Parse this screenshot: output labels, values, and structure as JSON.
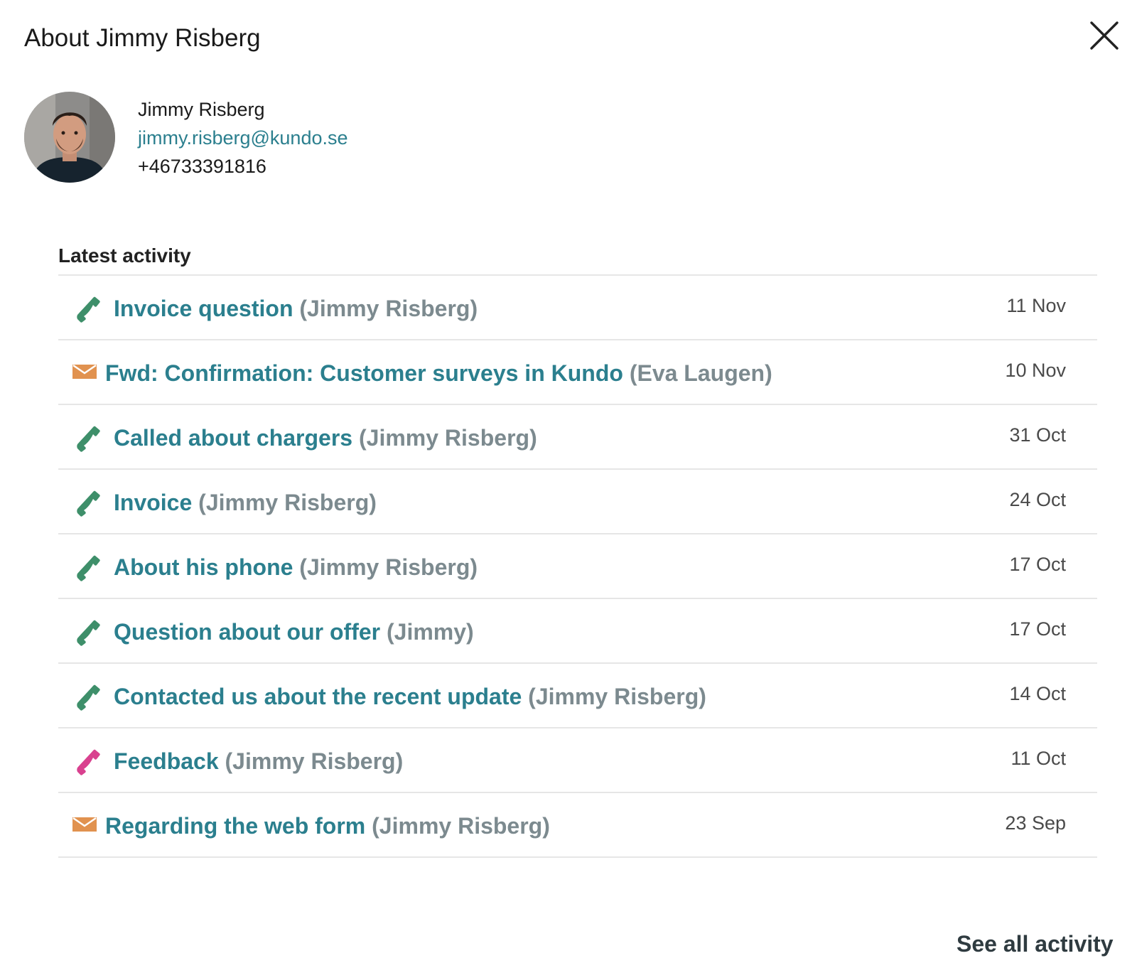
{
  "dialog": {
    "title": "About Jimmy Risberg",
    "close_icon": "close-icon"
  },
  "contact": {
    "name": "Jimmy Risberg",
    "email": "jimmy.risberg@kundo.se",
    "phone": "+46733391816"
  },
  "activity": {
    "heading": "Latest activity",
    "items": [
      {
        "type": "phone",
        "icon": "phone-icon",
        "color": "#3e8f6a",
        "subject": "Invoice question",
        "author": "(Jimmy Risberg)",
        "date": "11 Nov"
      },
      {
        "type": "mail",
        "icon": "mail-icon",
        "color": "#e1924f",
        "subject": "Fwd: Confirmation: Customer surveys in Kundo",
        "author": "(Eva Laugen)",
        "date": "10 Nov"
      },
      {
        "type": "phone",
        "icon": "phone-icon",
        "color": "#3e8f6a",
        "subject": "Called about chargers",
        "author": "(Jimmy Risberg)",
        "date": "31 Oct"
      },
      {
        "type": "phone",
        "icon": "phone-icon",
        "color": "#3e8f6a",
        "subject": "Invoice",
        "author": "(Jimmy Risberg)",
        "date": "24 Oct"
      },
      {
        "type": "phone",
        "icon": "phone-icon",
        "color": "#3e8f6a",
        "subject": "About his phone",
        "author": "(Jimmy Risberg)",
        "date": "17 Oct"
      },
      {
        "type": "phone",
        "icon": "phone-icon",
        "color": "#3e8f6a",
        "subject": "Question about our offer",
        "author": "(Jimmy)",
        "date": "17 Oct"
      },
      {
        "type": "phone",
        "icon": "phone-icon",
        "color": "#3e8f6a",
        "subject": "Contacted us about the recent update",
        "author": "(Jimmy Risberg)",
        "date": "14 Oct"
      },
      {
        "type": "phone",
        "icon": "phone-icon",
        "color": "#d9418f",
        "subject": "Feedback",
        "author": "(Jimmy Risberg)",
        "date": "11 Oct"
      },
      {
        "type": "mail",
        "icon": "mail-icon",
        "color": "#e1924f",
        "subject": "Regarding the web form",
        "author": "(Jimmy Risberg)",
        "date": "23 Sep"
      }
    ]
  },
  "footer": {
    "see_all_label": "See all activity"
  }
}
